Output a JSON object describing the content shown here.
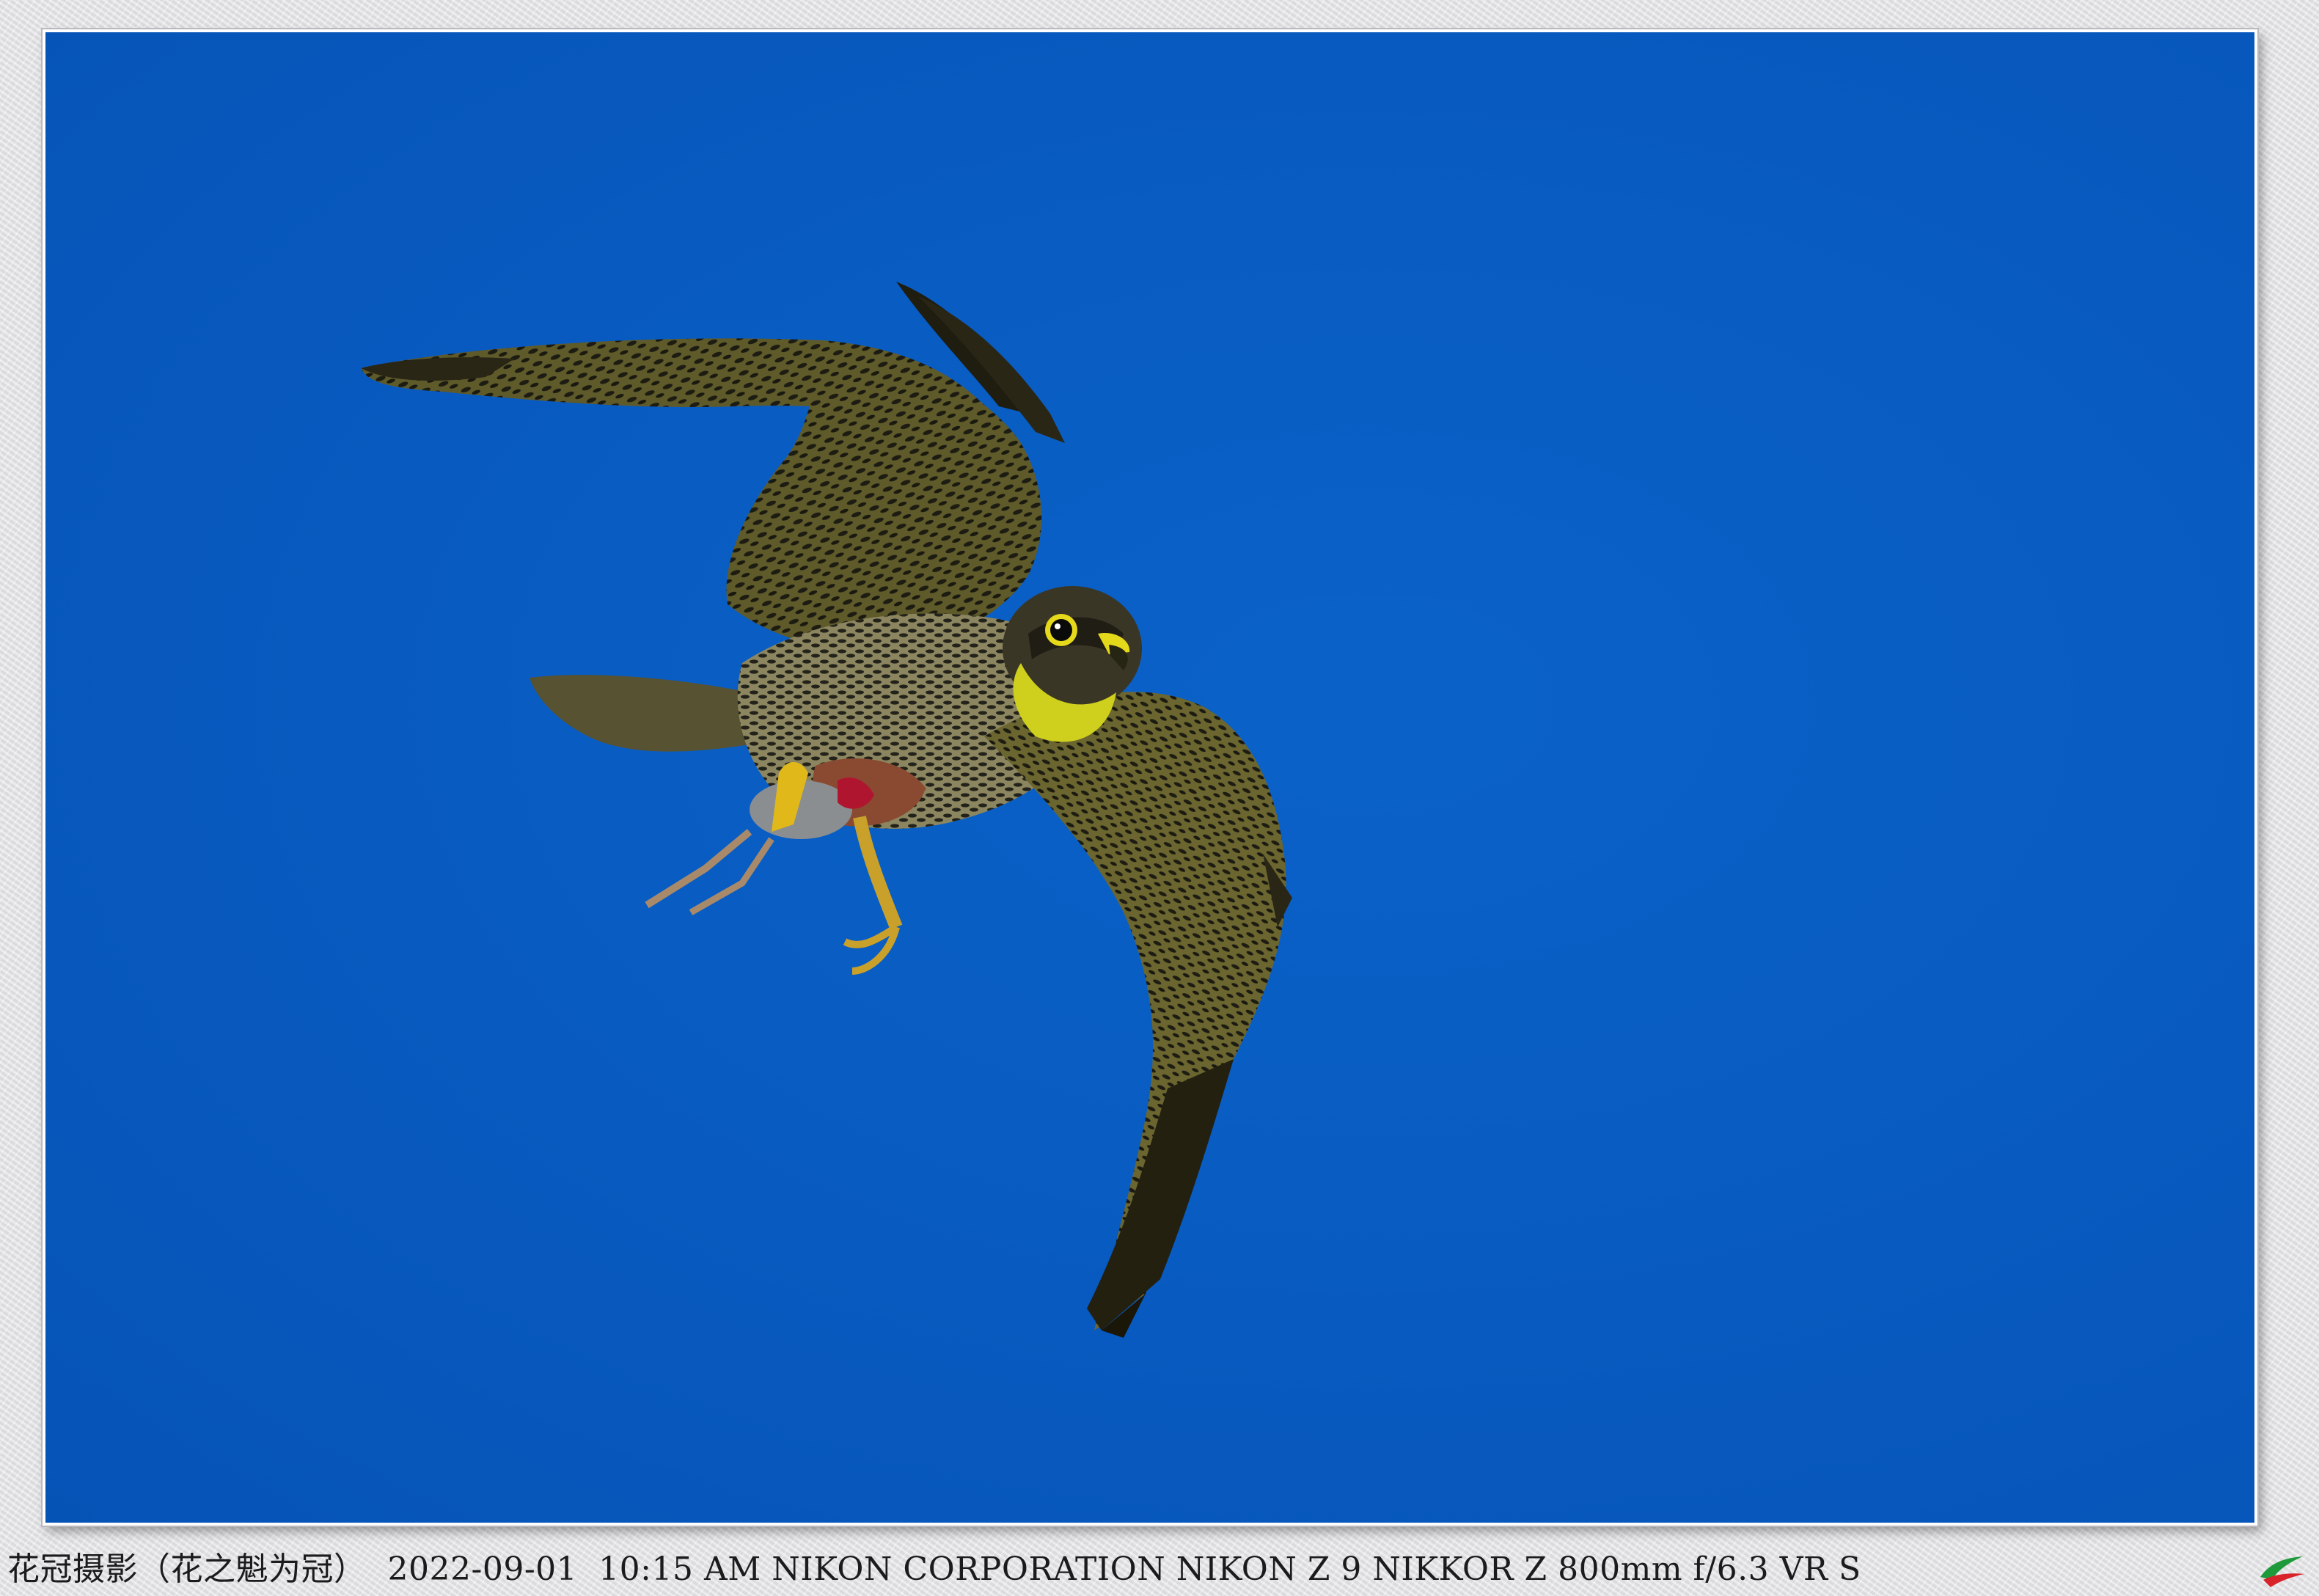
{
  "caption": {
    "author": "花冠摄影（花之魁为冠）",
    "date": "2022-09-01",
    "time": "10:15 AM",
    "camera": "NIKON CORPORATION NIKON Z 9",
    "lens": "NIKKOR Z 800mm f/6.3 VR S"
  },
  "photo": {
    "subject": "falcon-with-prey-in-flight",
    "sky_color": "#0b5ec0"
  },
  "logo": {
    "icon": "bird-site-logo-icon",
    "colors": [
      "#1e9a3a",
      "#d8232a"
    ]
  }
}
